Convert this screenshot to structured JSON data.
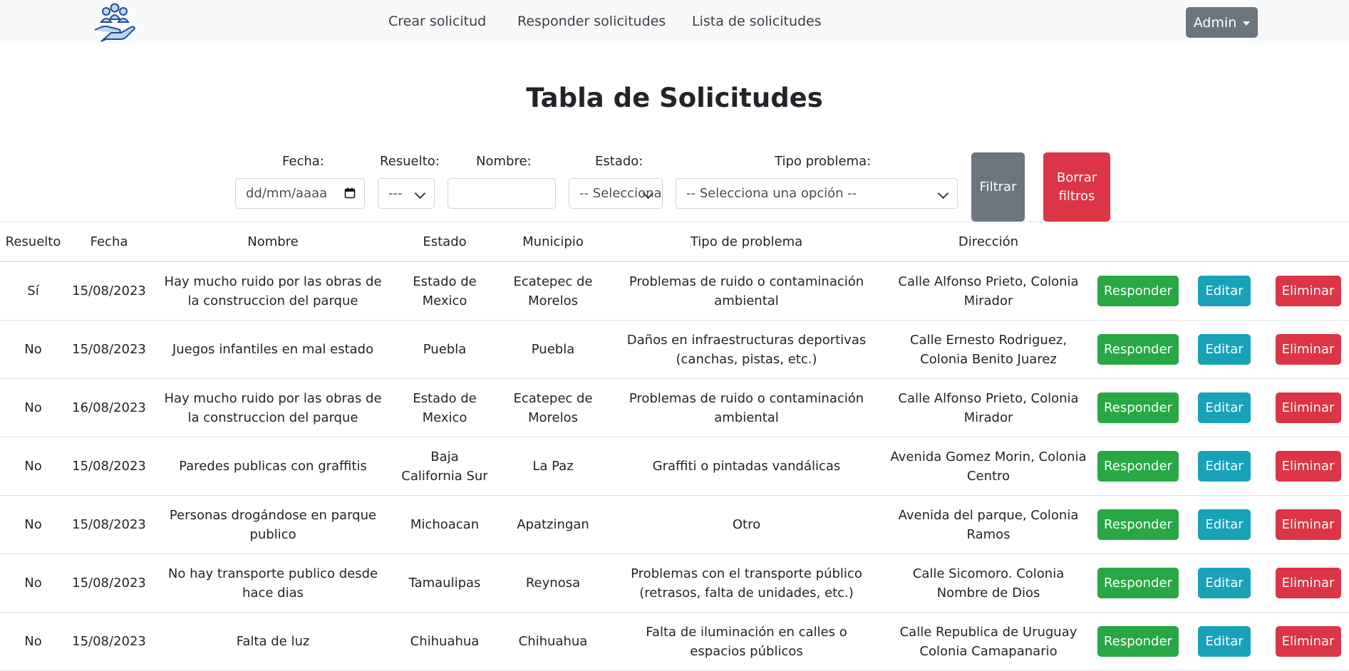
{
  "nav": {
    "links": [
      "Crear solicitud",
      "Responder solicitudes",
      "Lista de solicitudes"
    ],
    "admin_label": "Admin"
  },
  "page_title": "Tabla de Solicitudes",
  "filters": {
    "fecha_label": "Fecha:",
    "fecha_placeholder": "dd/mm/aaaa",
    "resuelto_label": "Resuelto:",
    "resuelto_value": "---",
    "nombre_label": "Nombre:",
    "nombre_value": "",
    "estado_label": "Estado:",
    "estado_value": "-- Selecciona una opción --",
    "tipo_label": "Tipo problema:",
    "tipo_value": "-- Selecciona una opción --",
    "filter_button": "Filtrar",
    "clear_button": "Borrar filtros"
  },
  "table": {
    "headers": [
      "Resuelto",
      "Fecha",
      "Nombre",
      "Estado",
      "Municipio",
      "Tipo de problema",
      "Dirección"
    ],
    "actions": {
      "respond": "Responder",
      "edit": "Editar",
      "delete": "Eliminar"
    },
    "rows": [
      [
        "Sí",
        "15/08/2023",
        "Hay mucho ruido por las obras de la construccion del parque",
        "Estado de Mexico",
        "Ecatepec de Morelos",
        "Problemas de ruido o contaminación ambiental",
        "Calle Alfonso Prieto, Colonia Mirador"
      ],
      [
        "No",
        "15/08/2023",
        "Juegos infantiles en mal estado",
        "Puebla",
        "Puebla",
        "Daños en infraestructuras deportivas (canchas, pistas, etc.)",
        "Calle Ernesto Rodriguez, Colonia Benito Juarez"
      ],
      [
        "No",
        "16/08/2023",
        "Hay mucho ruido por las obras de la construccion del parque",
        "Estado de Mexico",
        "Ecatepec de Morelos",
        "Problemas de ruido o contaminación ambiental",
        "Calle Alfonso Prieto, Colonia Mirador"
      ],
      [
        "No",
        "15/08/2023",
        "Paredes publicas con graffitis",
        "Baja California Sur",
        "La Paz",
        "Graffiti o pintadas vandálicas",
        "Avenida Gomez Morin, Colonia Centro"
      ],
      [
        "No",
        "15/08/2023",
        "Personas drogándose en parque publico",
        "Michoacan",
        "Apatzingan",
        "Otro",
        "Avenida del parque, Colonia Ramos"
      ],
      [
        "No",
        "15/08/2023",
        "No hay transporte publico desde hace dias",
        "Tamaulipas",
        "Reynosa",
        "Problemas con el transporte público (retrasos, falta de unidades, etc.)",
        "Calle Sicomoro. Colonia Nombre de Dios"
      ],
      [
        "No",
        "15/08/2023",
        "Falta de luz",
        "Chihuahua",
        "Chihuahua",
        "Falta de iluminación en calles o espacios públicos",
        "Calle Republica de Uruguay Colonia Camapanario"
      ]
    ]
  }
}
